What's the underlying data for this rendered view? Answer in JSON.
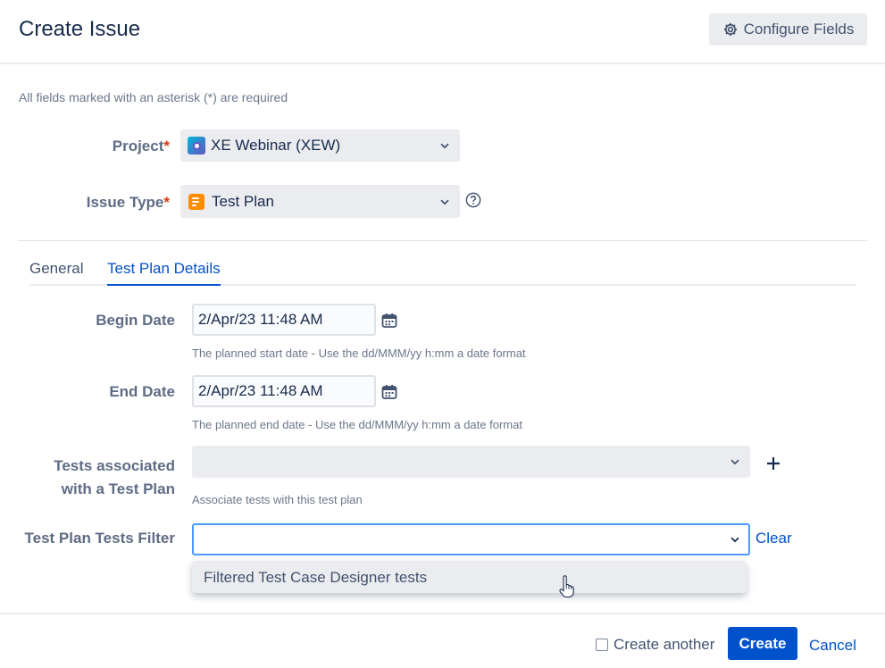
{
  "header": {
    "title": "Create Issue",
    "configure_label": "Configure Fields"
  },
  "required_note": "All fields marked with an asterisk (*) are required",
  "fields": {
    "project": {
      "label": "Project",
      "required_mark": "*",
      "value": "XE Webinar (XEW)",
      "icon": "project-avatar-icon"
    },
    "issue_type": {
      "label": "Issue Type",
      "required_mark": "*",
      "value": "Test Plan",
      "icon": "test-plan-icon"
    }
  },
  "tabs": [
    {
      "label": "General",
      "active": false
    },
    {
      "label": "Test Plan Details",
      "active": true
    }
  ],
  "details": {
    "begin_date": {
      "label": "Begin Date",
      "value": "2/Apr/23 11:48 AM",
      "hint": "The planned start date - Use the dd/MMM/yy h:mm a date format"
    },
    "end_date": {
      "label": "End Date",
      "value": "2/Apr/23 11:48 AM",
      "hint": "The planned end date - Use the dd/MMM/yy h:mm a date format"
    },
    "tests": {
      "label_line1": "Tests associated",
      "label_line2": "with a Test Plan",
      "value": "",
      "hint": "Associate tests with this test plan"
    },
    "filter": {
      "label": "Test Plan Tests Filter",
      "value": "",
      "clear_label": "Clear",
      "options": [
        "Filtered Test Case Designer tests"
      ]
    }
  },
  "footer": {
    "create_another_label": "Create another",
    "create_another_checked": false,
    "create_label": "Create",
    "cancel_label": "Cancel"
  },
  "colors": {
    "accent": "#0052cc",
    "required": "#de350b",
    "focus": "#4c9aff"
  }
}
